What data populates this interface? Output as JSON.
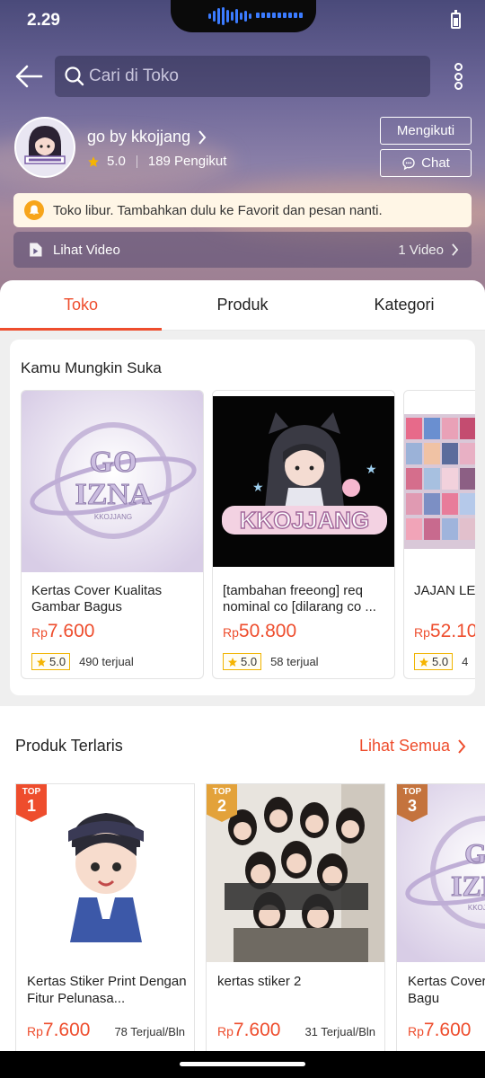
{
  "status": {
    "time": "2.29"
  },
  "search": {
    "placeholder": "Cari di Toko"
  },
  "shop": {
    "name": "go by kkojjang",
    "rating": "5.0",
    "followers": "189 Pengikut",
    "follow_label": "Mengikuti",
    "chat_label": "Chat"
  },
  "notice": {
    "text": "Toko libur. Tambahkan dulu ke Favorit dan pesan nanti."
  },
  "video": {
    "label": "Lihat Video",
    "count": "1 Video"
  },
  "tabs": [
    {
      "label": "Toko",
      "active": true
    },
    {
      "label": "Produk",
      "active": false
    },
    {
      "label": "Kategori",
      "active": false
    }
  ],
  "recommend": {
    "title": "Kamu Mungkin Suka",
    "items": [
      {
        "name": "Kertas Cover Kualitas Gambar Bagus",
        "currency": "Rp",
        "price": "7.600",
        "rating": "5.0",
        "sold": "490 terjual"
      },
      {
        "name": "[tambahan freeong] req nominal co [dilarang co ...",
        "currency": "Rp",
        "price": "50.800",
        "rating": "5.0",
        "sold": "58 terjual"
      },
      {
        "name": "JAJAN LE",
        "currency": "Rp",
        "price": "52.10",
        "rating": "5.0",
        "sold": "4"
      }
    ]
  },
  "best": {
    "title": "Produk Terlaris",
    "see_all": "Lihat Semua",
    "items": [
      {
        "badge_top": "TOP",
        "rank": "1",
        "name": "Kertas Stiker Print Dengan Fitur Pelunasa...",
        "currency": "Rp",
        "price": "7.600",
        "sold": "78 Terjual/Bln",
        "badge_color": "#ee4d2d"
      },
      {
        "badge_top": "TOP",
        "rank": "2",
        "name": "kertas stiker 2",
        "currency": "Rp",
        "price": "7.600",
        "sold": "31 Terjual/Bln",
        "badge_color": "#e3a23a"
      },
      {
        "badge_top": "TOP",
        "rank": "3",
        "name": "Kertas Cover Gambar Bagu",
        "currency": "Rp",
        "price": "7.600",
        "sold": "",
        "badge_color": "#c4733d"
      }
    ]
  },
  "colors": {
    "accent": "#ee4d2d",
    "star": "#f5b400"
  }
}
